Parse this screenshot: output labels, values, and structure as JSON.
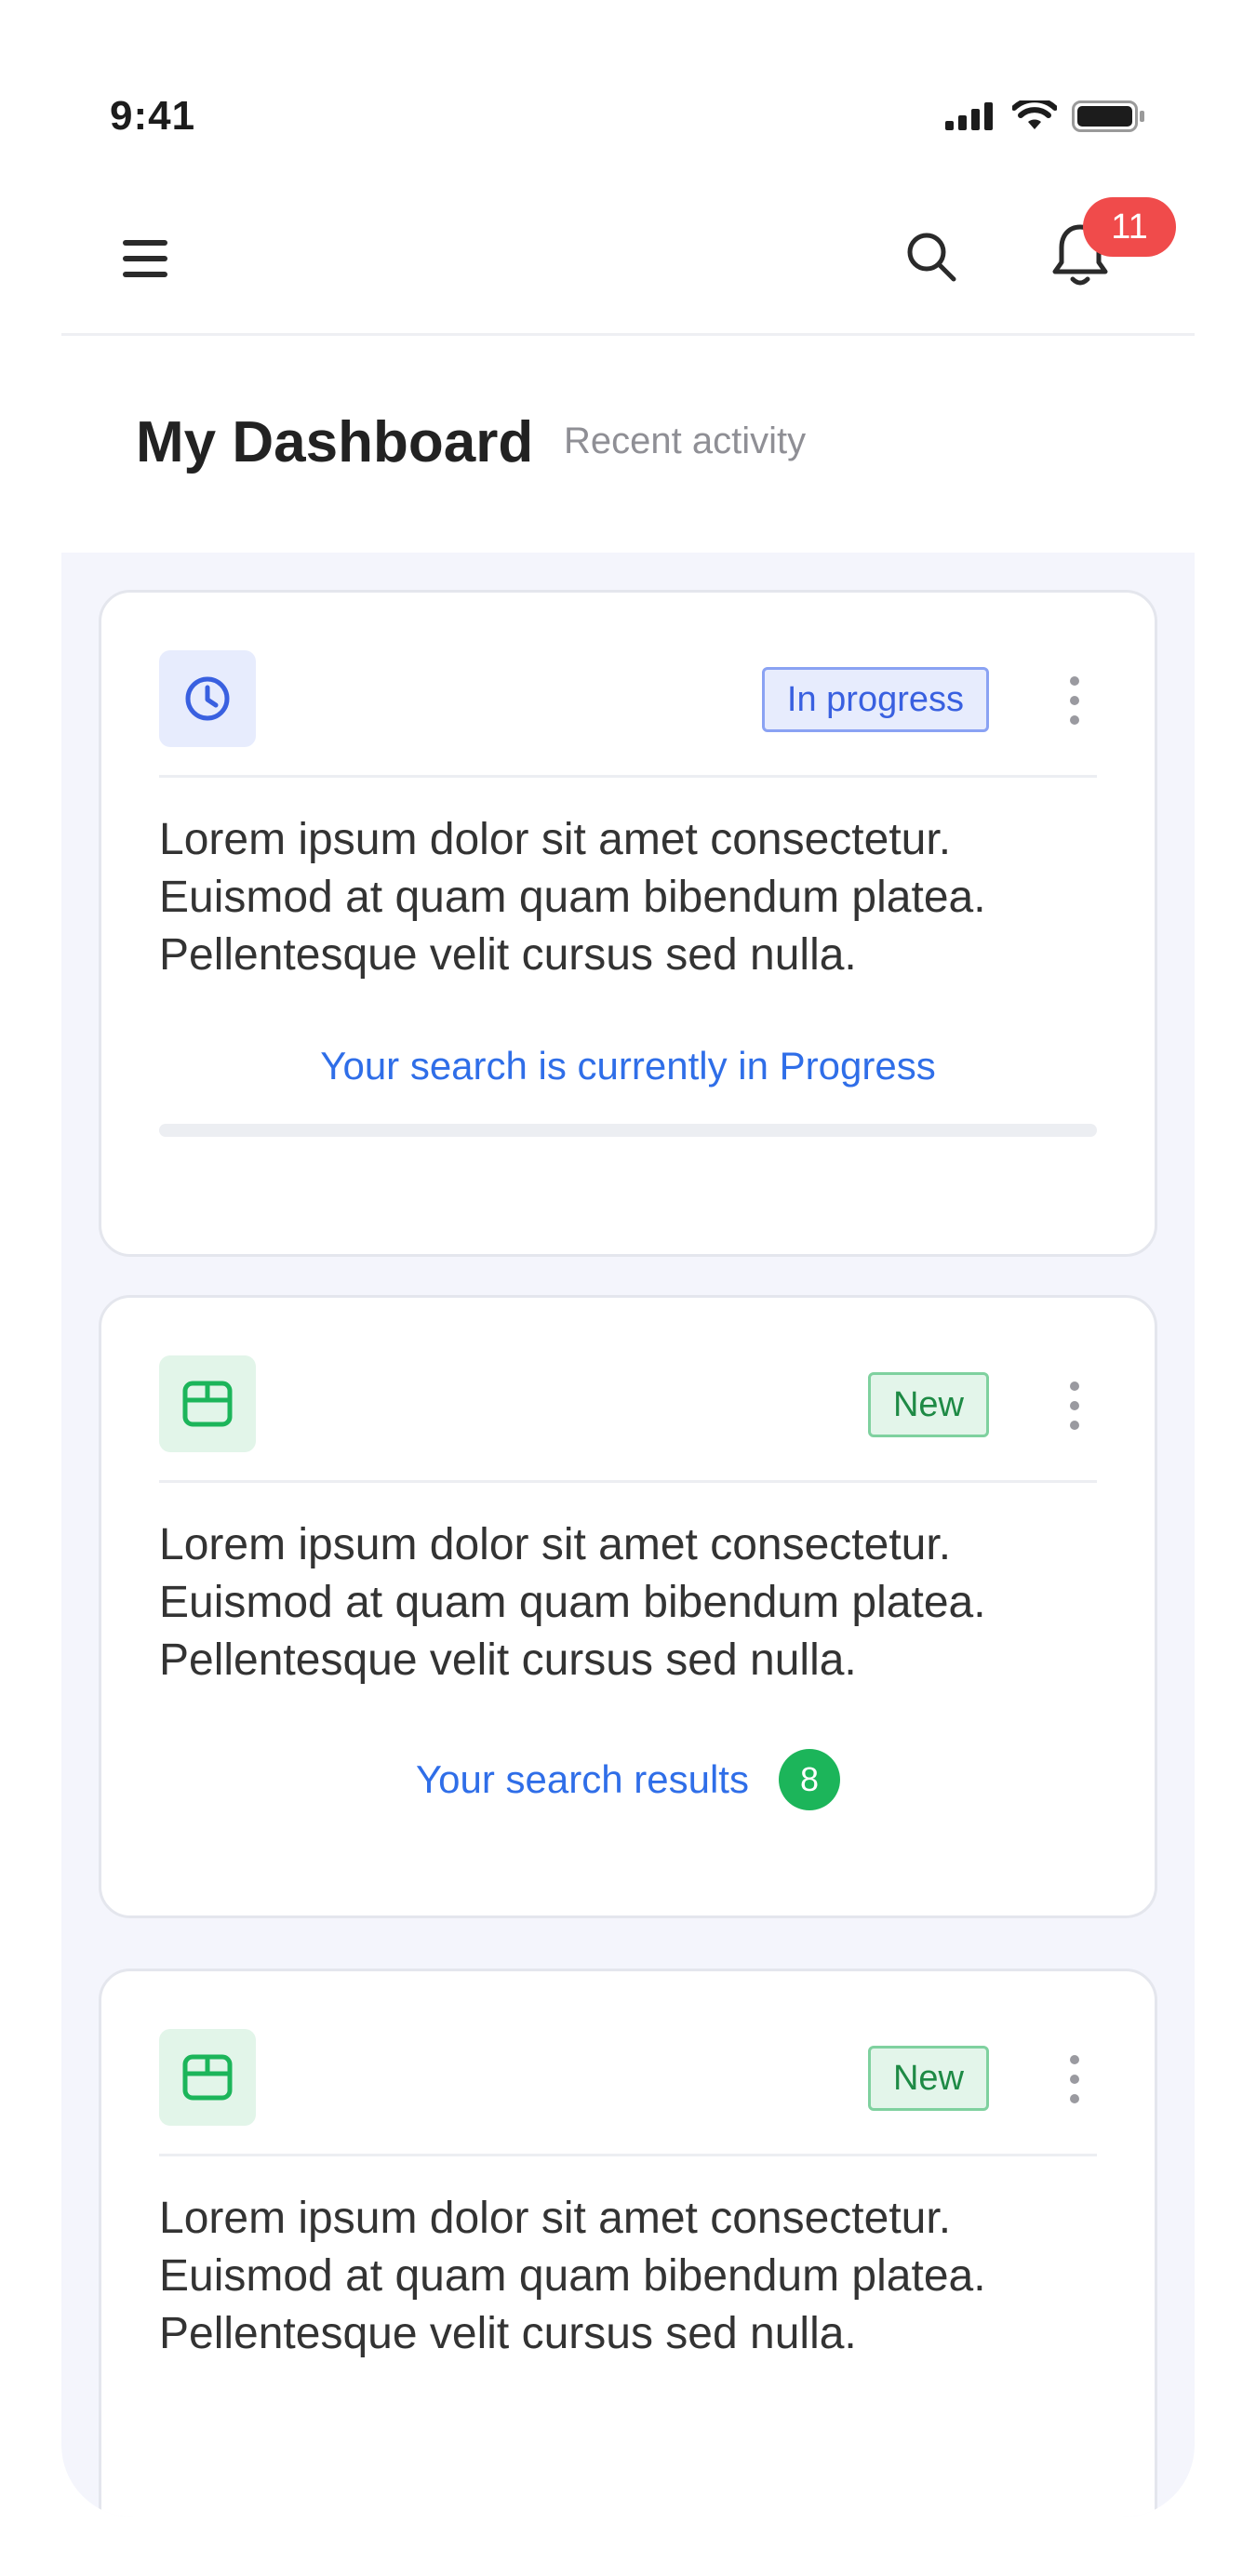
{
  "status_bar": {
    "time": "9:41"
  },
  "header": {
    "notification_count": "11"
  },
  "page": {
    "title": "My Dashboard",
    "subtitle": "Recent activity"
  },
  "cards": [
    {
      "icon": "clock-icon",
      "badge": "In progress",
      "text": "Lorem ipsum dolor sit amet consectetur. Euismod at quam quam bibendum platea. Pellentesque velit cursus sed nulla.",
      "footer": "Your search is currently in Progress"
    },
    {
      "icon": "box-icon",
      "badge": "New",
      "text": "Lorem ipsum dolor sit amet consectetur. Euismod at quam quam bibendum platea. Pellentesque velit cursus sed nulla.",
      "footer": "Your search results",
      "results_count": "8"
    },
    {
      "icon": "box-icon",
      "badge": "New",
      "text": "Lorem ipsum dolor sit amet consectetur. Euismod at quam quam bibendum platea. Pellentesque velit cursus sed nulla."
    }
  ],
  "colors": {
    "accent_blue": "#2f6ee8",
    "progress_badge": "#3960e0",
    "new_badge": "#1e8a45",
    "notification_badge": "#f04b4b",
    "count_badge": "#1cb55a"
  }
}
